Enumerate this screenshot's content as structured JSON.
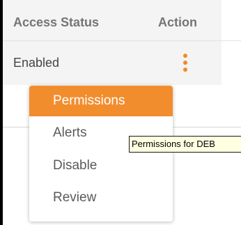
{
  "table": {
    "headers": {
      "access_status": "Access Status",
      "action": "Action"
    },
    "rows": [
      {
        "access_status": "Enabled"
      }
    ]
  },
  "action_icon": "kebab-vertical-icon",
  "menu": {
    "items": [
      {
        "label": "Permissions",
        "active": true
      },
      {
        "label": "Alerts",
        "active": false
      },
      {
        "label": "Disable",
        "active": false
      },
      {
        "label": "Review",
        "active": false
      }
    ]
  },
  "tooltip": {
    "text": "Permissions for DEB"
  },
  "colors": {
    "accent": "#f28d2d",
    "tooltip_background": "#ffffe1",
    "row_background": "#f4f4f4"
  }
}
